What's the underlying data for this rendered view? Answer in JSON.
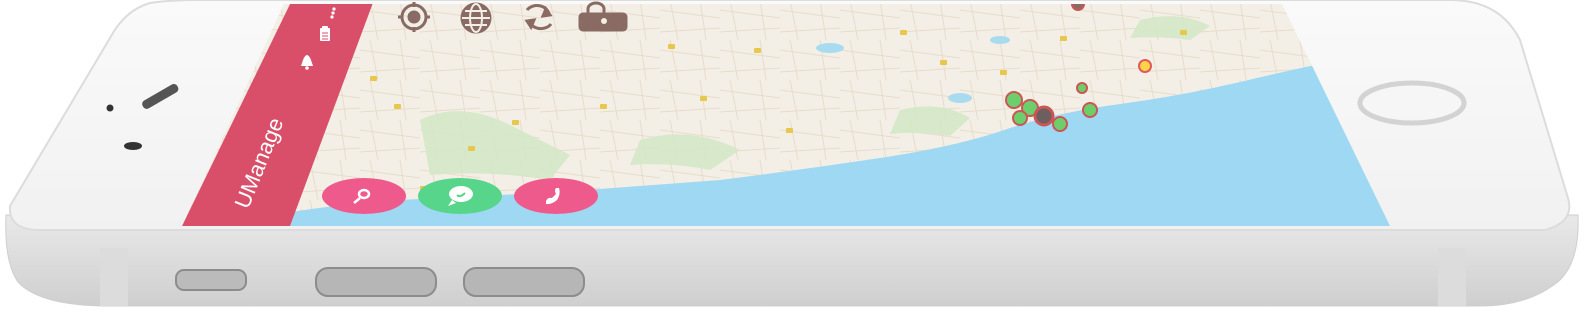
{
  "app": {
    "title": "UManage",
    "header_color": "#d94f6a"
  },
  "toolbar": {
    "icons": [
      "bell-icon",
      "clipboard-icon",
      "more-vert-icon"
    ]
  },
  "map_controls": {
    "icons": [
      "locate-icon",
      "globe-icon",
      "refresh-icon",
      "lock-icon"
    ],
    "color": "#8a6b64"
  },
  "fabs": [
    {
      "name": "search-button",
      "icon": "search-icon",
      "color": "#ef5a8c"
    },
    {
      "name": "chat-button",
      "icon": "chat-icon",
      "color": "#57d58a"
    },
    {
      "name": "phone-button",
      "icon": "phone-icon",
      "color": "#ef5a8c"
    }
  ],
  "colors": {
    "land": "#f3efe6",
    "water": "#9fd8f3",
    "green": "#cfe6c3"
  }
}
